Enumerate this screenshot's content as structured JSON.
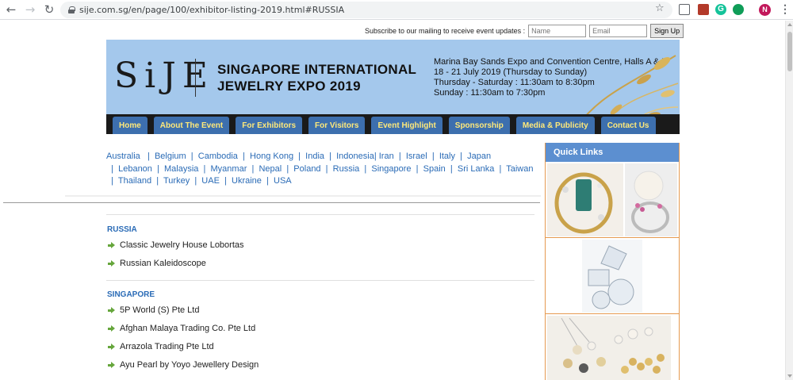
{
  "browser": {
    "url": "sije.com.sg/en/page/100/exhibitor-listing-2019.html#RUSSIA",
    "avatar_letter": "N",
    "ext_g_letter": "G"
  },
  "subscribe": {
    "label": "Subscribe to our mailing to receive event updates :",
    "name_placeholder": "Name",
    "email_placeholder": "Email",
    "button": "Sign Up"
  },
  "banner": {
    "logo": "SiJE",
    "title_line1": "SINGAPORE INTERNATIONAL",
    "title_line2": "JEWELRY EXPO 2019",
    "venue_line1": "Marina Bay Sands Expo and Convention Centre, Halls A & B",
    "venue_line2": "18 - 21 July 2019 (Thursday to Sunday)",
    "venue_line3": "Thursday - Saturday : 11:30am to 8:30pm",
    "venue_line4": "Sunday : 11:30am to 7:30pm"
  },
  "nav": [
    "Home",
    "About The Event",
    "For Exhibitors",
    "For Visitors",
    "Event Highlight",
    "Sponsorship",
    "Media & Publicity",
    "Contact Us"
  ],
  "countries": [
    "Australia",
    "Belgium",
    "Cambodia",
    "Hong Kong",
    "India",
    "Indonesia",
    "Iran",
    "Israel",
    "Italy",
    "Japan",
    "Lebanon",
    "Malaysia",
    "Myanmar",
    "Nepal",
    "Poland",
    "Russia",
    "Singapore",
    "Spain",
    "Sri Lanka",
    "Taiwan",
    "Thailand",
    "Turkey",
    "UAE",
    "Ukraine",
    "USA"
  ],
  "sections": [
    {
      "title": "RUSSIA",
      "items": [
        "Classic Jewelry House Lobortas",
        "Russian Kaleidoscope"
      ]
    },
    {
      "title": "SINGAPORE",
      "items": [
        "5P World (S) Pte Ltd",
        "Afghan Malaya Trading Co. Pte Ltd",
        "Arrazola Trading Pte Ltd",
        "Ayu Pearl by Yoyo Jewellery Design"
      ]
    }
  ],
  "quick_links": {
    "title": "Quick Links"
  },
  "colors": {
    "banner": "#a4c8ec",
    "nav_tab": "#3d6fae",
    "nav_text": "#ffe97a",
    "link": "#2a6bb6",
    "quick_head": "#5c8fd0",
    "quick_border": "#e69a50"
  }
}
